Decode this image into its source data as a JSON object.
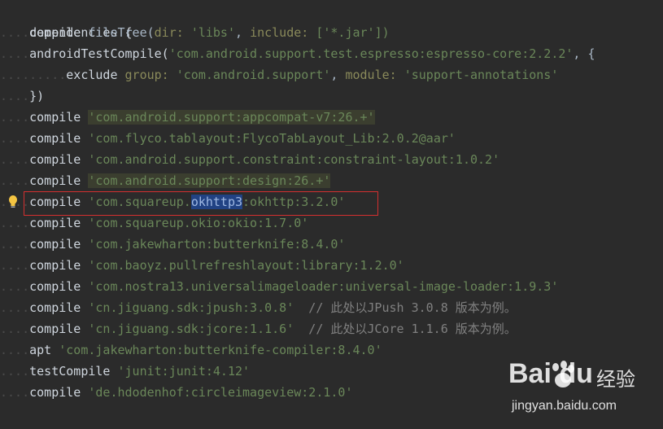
{
  "editor": {
    "lines": [
      {
        "seg": [
          "dependencies {"
        ]
      },
      {
        "seg": [
          "compile ",
          "fileTree(",
          "dir: ",
          "'libs'",
          ", ",
          "include: ",
          "['*.jar'])"
        ]
      },
      {
        "seg": [
          "androidTestCompile(",
          "'com.android.support.test.espresso:espresso-core:2.2.2'",
          ", {"
        ]
      },
      {
        "seg": [
          "exclude ",
          "group: ",
          "'com.android.support'",
          ", ",
          "module: ",
          "'support-annotations'"
        ]
      },
      {
        "seg": [
          "})"
        ]
      },
      {
        "seg": [
          "compile ",
          "'com.android.support:appcompat-v7:26.+'"
        ]
      },
      {
        "seg": [
          "compile ",
          "'com.flyco.tablayout:FlycoTabLayout_Lib:2.0.2@aar'"
        ]
      },
      {
        "seg": [
          "compile ",
          "'com.android.support.constraint:constraint-layout:1.0.2'"
        ]
      },
      {
        "seg": [
          "compile ",
          "'com.android.support:design:26.+'"
        ]
      },
      {
        "seg": [
          "compile ",
          "'com.squareup.",
          "okhttp3",
          ":okhttp:3.2.0'"
        ]
      },
      {
        "seg": [
          "compile ",
          "'com.squareup.okio:okio:1.7.0'"
        ]
      },
      {
        "seg": [
          "compile ",
          "'com.jakewharton:butterknife:8.4.0'"
        ]
      },
      {
        "seg": [
          "compile ",
          "'com.baoyz.pullrefreshlayout:library:1.2.0'"
        ]
      },
      {
        "seg": [
          "compile ",
          "'com.nostra13.universalimageloader:universal-image-loader:1.9.3'"
        ]
      },
      {
        "seg": [
          "compile ",
          "'cn.jiguang.sdk:jpush:3.0.8'",
          "  // 此处以JPush 3.0.8 版本为例。"
        ]
      },
      {
        "seg": [
          "compile ",
          "'cn.jiguang.sdk:jcore:1.1.6'",
          "  // 此处以JCore 1.1.6 版本为例。"
        ]
      },
      {
        "seg": [
          "apt ",
          "'com.jakewharton:butterknife-compiler:8.4.0'"
        ]
      },
      {
        "seg": [
          "testCompile ",
          "'junit:junit:4.12'"
        ]
      },
      {
        "seg": [
          "compile ",
          "'de.hdodenhof:circleimageview:2.1.0'"
        ]
      },
      {
        "seg": [
          "}"
        ]
      }
    ]
  },
  "watermark": {
    "logo": "Bai du",
    "jingyan": "经验",
    "url": "jingyan.baidu.com"
  },
  "icons": {
    "bulb": "lightbulb-icon",
    "paw": "baidu-paw-icon"
  },
  "colors": {
    "background": "#2b2b2b",
    "string": "#6a8759",
    "selection": "#214283",
    "highlight_box": "#d32f2f"
  }
}
